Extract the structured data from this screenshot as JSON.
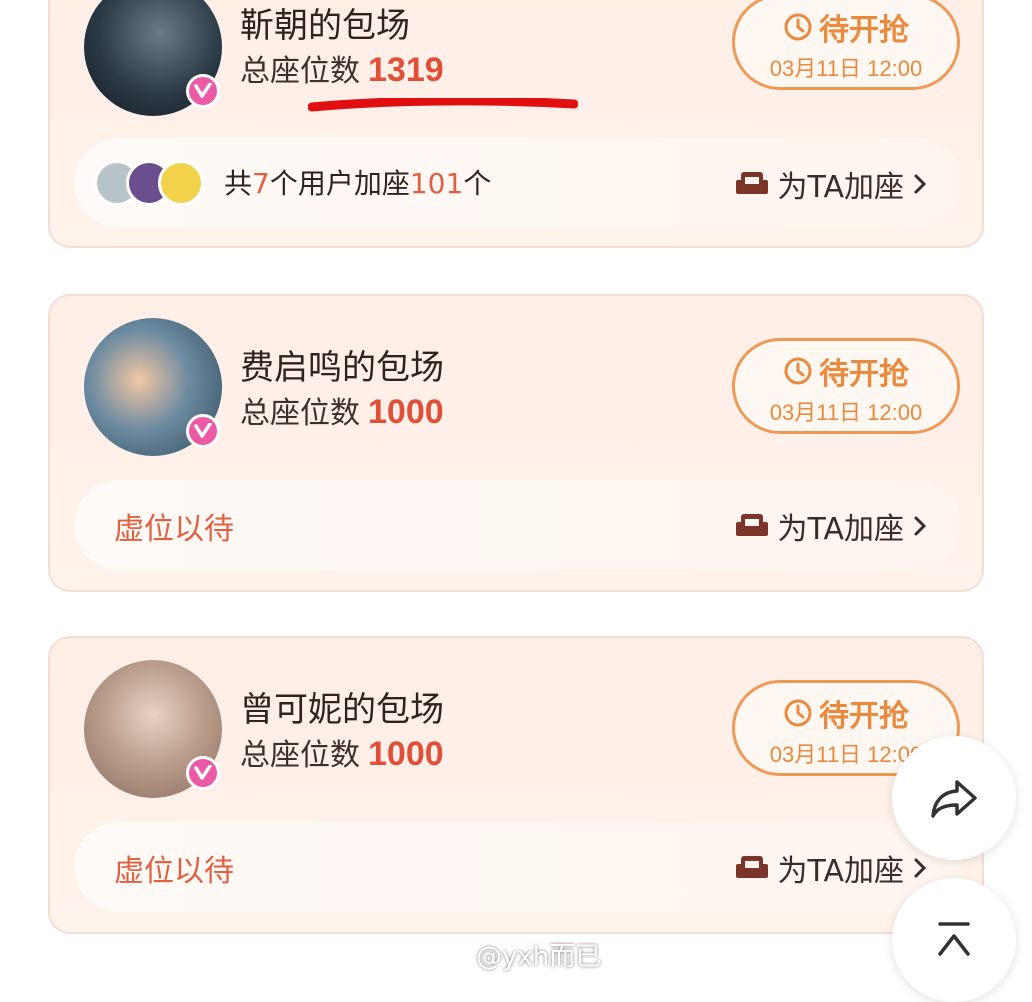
{
  "cards": [
    {
      "title": "靳朝的包场",
      "seats_label": "总座位数",
      "seats_value": "1319",
      "grab_label": "待开抢",
      "grab_time": "03月11日 12:00",
      "joined_prefix": "共",
      "joined_users": "7",
      "joined_mid": "个用户加座",
      "joined_seats": "101",
      "joined_suffix": "个",
      "add_label": "为TA加座"
    },
    {
      "title": "费启鸣的包场",
      "seats_label": "总座位数",
      "seats_value": "1000",
      "grab_label": "待开抢",
      "grab_time": "03月11日 12:00",
      "empty_label": "虚位以待",
      "add_label": "为TA加座"
    },
    {
      "title": "曾可妮的包场",
      "seats_label": "总座位数",
      "seats_value": "1000",
      "grab_label": "待开抢",
      "grab_time": "03月11日 12:00",
      "empty_label": "虚位以待",
      "add_label": "为TA加座"
    }
  ],
  "watermark": "@yxh而已",
  "icons": {
    "verified": "verified-badge-icon",
    "clock": "clock-icon",
    "seat": "sofa-icon",
    "chevron": "chevron-right-icon",
    "share": "share-icon",
    "top": "back-to-top-icon"
  },
  "colors": {
    "accent_orange": "#e98a3d",
    "seat_red": "#e24f37",
    "verify_pink": "#ec5aa6",
    "annotation_red": "#e01010"
  }
}
